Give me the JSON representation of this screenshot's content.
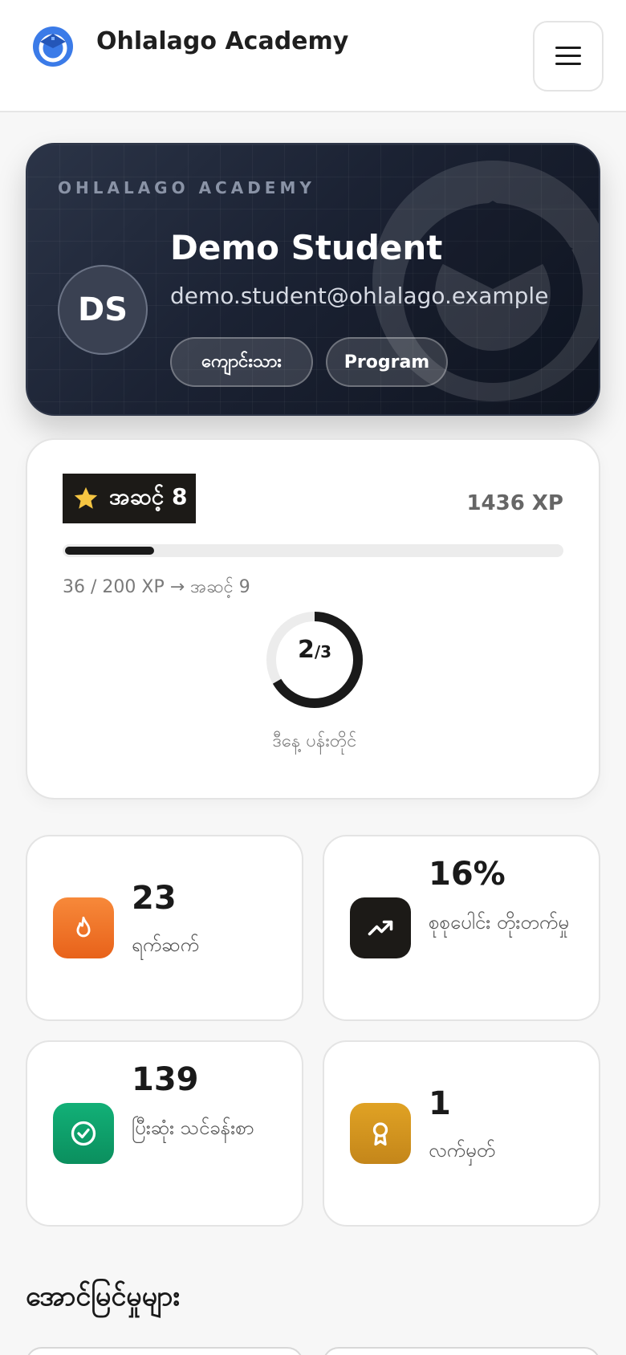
{
  "header": {
    "brand": "Ohlalago Academy",
    "logo_icon": "academy-logo-icon",
    "menu_icon": "hamburger-menu-icon"
  },
  "profile": {
    "kicker": "OHLALAGO ACADEMY",
    "initials": "DS",
    "name": "Demo Student",
    "email": "demo.student@ohlalago.example",
    "tags": [
      "ကျောင်းသား",
      "Program"
    ]
  },
  "level": {
    "badge_label": "အဆင့် 8",
    "badge_icon": "star-icon",
    "xp_total": "1436 XP",
    "progress_fraction": 0.18,
    "progress_text": "36 / 200 XP → အဆင့် 9",
    "daily_goal_done": "2",
    "daily_goal_total": "/3",
    "daily_goal_fraction": 0.6667,
    "daily_goal_caption": "ဒီနေ့ ပန်းတိုင်"
  },
  "stats": [
    {
      "value": "23",
      "label": "ရက်ဆက်",
      "icon": "flame-icon",
      "color": "#f06f1f"
    },
    {
      "value": "16%",
      "label": "စုစုပေါင်း တိုးတက်မှု",
      "icon": "trending-up-icon",
      "color": "#1c1a17"
    },
    {
      "value": "139",
      "label": "ပြီးဆုံး သင်ခန်းစာ",
      "icon": "check-circle-icon",
      "color": "#10a06a"
    },
    {
      "value": "1",
      "label": "လက်မှတ်",
      "icon": "award-icon",
      "color": "#d4961a"
    }
  ],
  "achievements": {
    "title": "အောင်မြင်မှုများ"
  },
  "colors": {
    "accent": "#1a1a1a",
    "logo_blue": "#3b7be8",
    "card_bg": "#ffffff",
    "profile_dark": "#1b2233"
  }
}
